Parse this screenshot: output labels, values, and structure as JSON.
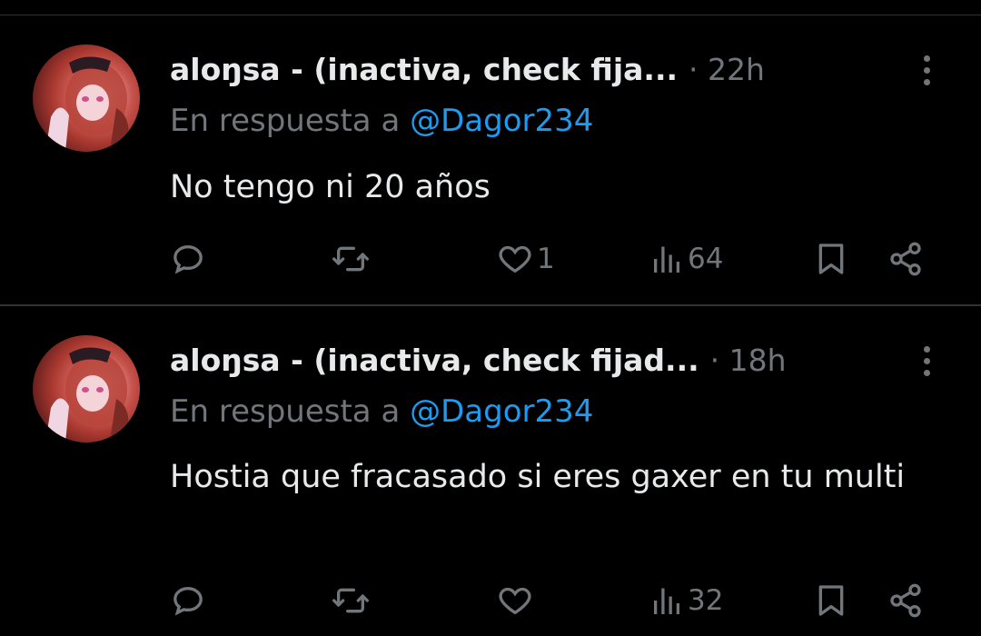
{
  "colors": {
    "background": "#000000",
    "text_primary": "#e7e9ea",
    "text_secondary": "#71767b",
    "mention": "#1d9bf0",
    "divider": "#2f3336"
  },
  "tweets": [
    {
      "author_name": "aloŋsa - (inactiva, check fija...",
      "time": "· 22h",
      "reply_prefix": "En respuesta a",
      "reply_mention": "@Dagor234",
      "text": "No tengo ni 20 años",
      "actions": {
        "reply_icon": "reply-icon",
        "retweet_icon": "retweet-icon",
        "like_icon": "heart-icon",
        "like_count": "1",
        "views_icon": "views-icon",
        "views_count": "64",
        "bookmark_icon": "bookmark-icon",
        "share_icon": "share-icon"
      }
    },
    {
      "author_name": "aloŋsa - (inactiva, check fijad...",
      "time": "· 18h",
      "reply_prefix": "En respuesta a",
      "reply_mention": "@Dagor234",
      "text": "Hostia que fracasado si eres gaxer en tu multi",
      "actions": {
        "reply_icon": "reply-icon",
        "retweet_icon": "retweet-icon",
        "like_icon": "heart-icon",
        "like_count": "",
        "views_icon": "views-icon",
        "views_count": "32",
        "bookmark_icon": "bookmark-icon",
        "share_icon": "share-icon"
      }
    }
  ]
}
